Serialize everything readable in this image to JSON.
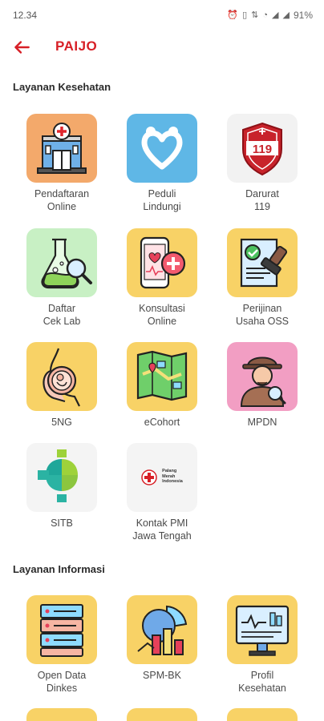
{
  "status_bar": {
    "time": "12.34",
    "battery": "91%"
  },
  "app_bar": {
    "title": "PAIJO"
  },
  "sections": {
    "kesehatan": "Layanan Kesehatan",
    "informasi": "Layanan Informasi"
  },
  "layanan_kesehatan": [
    {
      "label": "Pendaftaran\nOnline",
      "icon": "hospital-icon",
      "bg": "#f3a96b"
    },
    {
      "label": "Peduli\nLindungi",
      "icon": "heart-hands-icon",
      "bg": "#5fb7e6"
    },
    {
      "label": "Darurat\n119",
      "icon": "emergency-119-icon",
      "bg": "#f2f2f2"
    },
    {
      "label": "Daftar\nCek Lab",
      "icon": "lab-flask-icon",
      "bg": "#c8f0c4"
    },
    {
      "label": "Konsultasi\nOnline",
      "icon": "phone-medical-icon",
      "bg": "#f8d266"
    },
    {
      "label": "Perijinan\nUsaha OSS",
      "icon": "stamp-document-icon",
      "bg": "#f8d266"
    },
    {
      "label": "5NG",
      "icon": "pregnancy-icon",
      "bg": "#f8d266"
    },
    {
      "label": "eCohort",
      "icon": "map-icon",
      "bg": "#f8d266"
    },
    {
      "label": "MPDN",
      "icon": "detective-icon",
      "bg": "#f29ec3"
    },
    {
      "label": "SITB",
      "icon": "health-ministry-logo-icon",
      "bg": "#f4f4f4"
    },
    {
      "label": "Kontak PMI\nJawa Tengah",
      "icon": "pmi-logo-icon",
      "bg": "#f4f4f4",
      "logo_text": "Palang\nMerah\nIndonesia"
    }
  ],
  "layanan_informasi": [
    {
      "label": "Open Data\nDinkes",
      "icon": "server-database-icon",
      "bg": "#f8d266"
    },
    {
      "label": "SPM-BK",
      "icon": "chart-analytics-icon",
      "bg": "#f8d266"
    },
    {
      "label": "Profil\nKesehatan",
      "icon": "monitor-report-icon",
      "bg": "#f8d266"
    }
  ]
}
